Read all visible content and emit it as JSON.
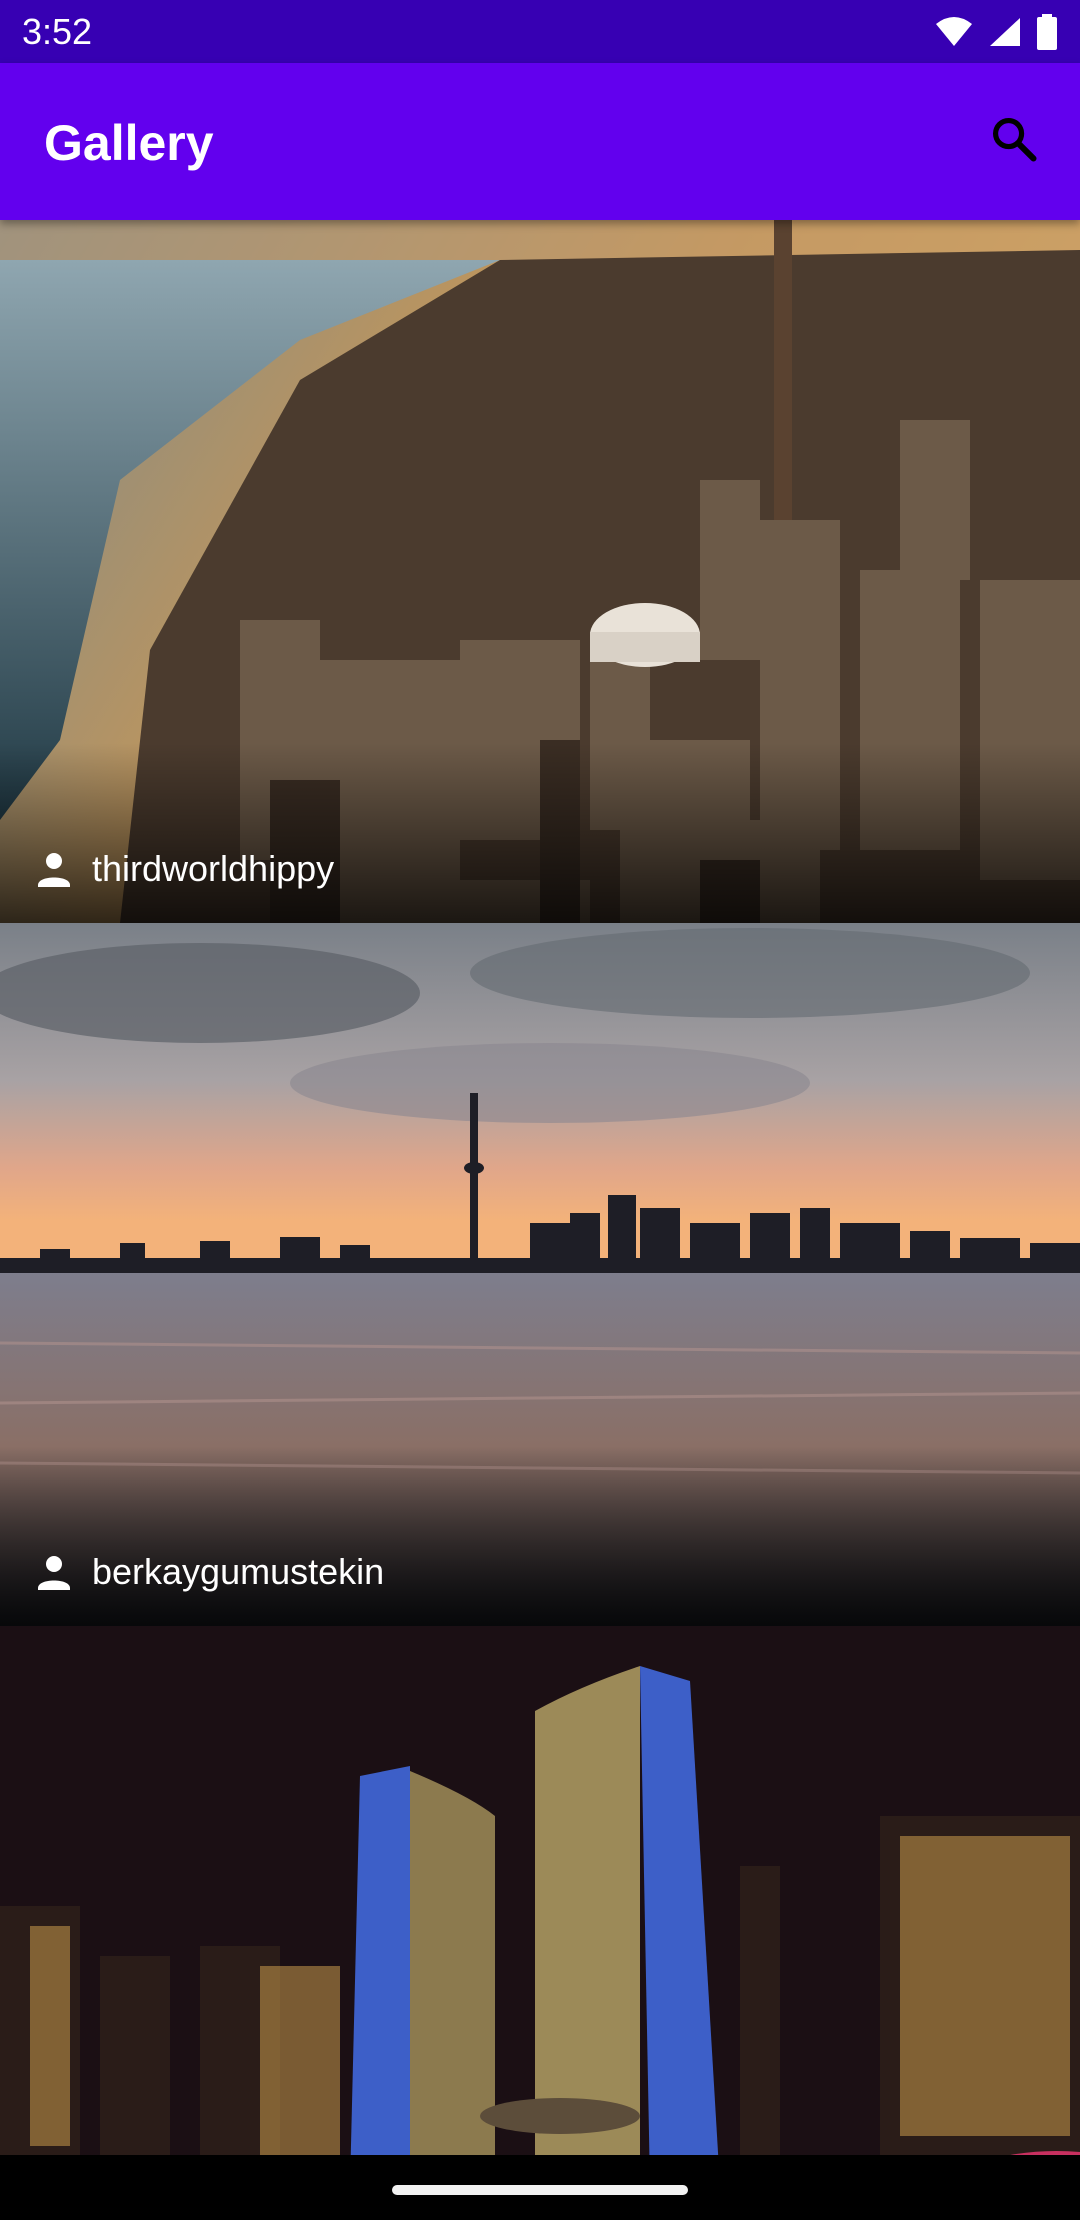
{
  "status_bar": {
    "time": "3:52",
    "icons": [
      "wifi-icon",
      "signal-icon",
      "battery-icon"
    ]
  },
  "app_bar": {
    "title": "Gallery",
    "search_icon": "search-icon",
    "colors": {
      "app_bar": "#6200EE",
      "status_bar": "#3700B3"
    }
  },
  "gallery": {
    "items": [
      {
        "author": "thirdworldhippy",
        "author_icon": "person-icon",
        "scene": "aerial city skyline by the lake at sunset"
      },
      {
        "author": "berkaygumustekin",
        "author_icon": "person-icon",
        "scene": "skyline across water at dusk"
      },
      {
        "author": "",
        "author_icon": "",
        "scene": "city hall towers at night"
      }
    ]
  }
}
